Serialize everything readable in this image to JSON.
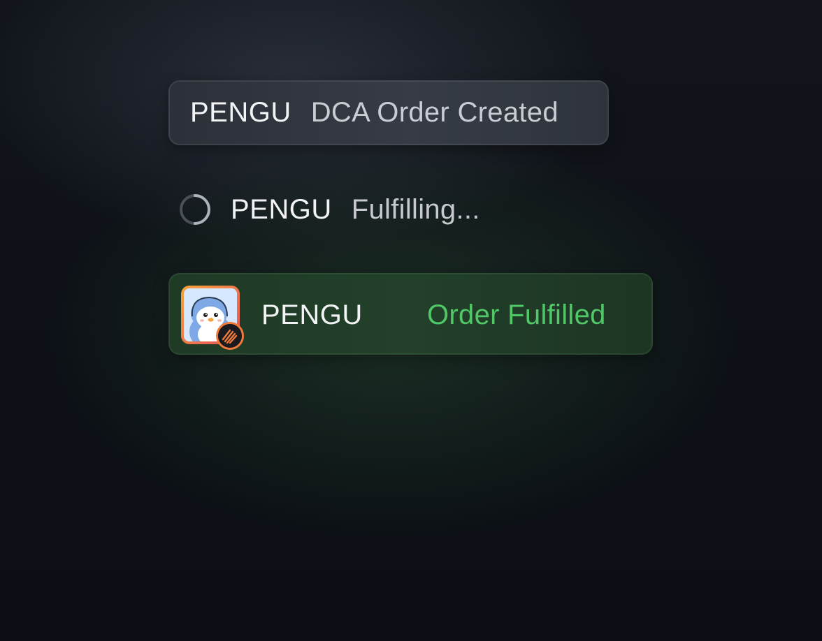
{
  "toasts": {
    "created": {
      "token": "PENGU",
      "status": "DCA Order Created"
    },
    "fulfilling": {
      "token": "PENGU",
      "status": "Fulfilling..."
    },
    "fulfilled": {
      "token": "PENGU",
      "status": "Order Fulfilled",
      "avatar_icon": "penguin-avatar",
      "badge_icon": "protocol-badge"
    }
  },
  "colors": {
    "success": "#52c768",
    "muted": "#c9ccd3",
    "primary_text": "#f2f3f5",
    "avatar_border_start": "#f5a53a",
    "avatar_border_end": "#e64f5b",
    "badge_ring": "#f07a3a"
  }
}
